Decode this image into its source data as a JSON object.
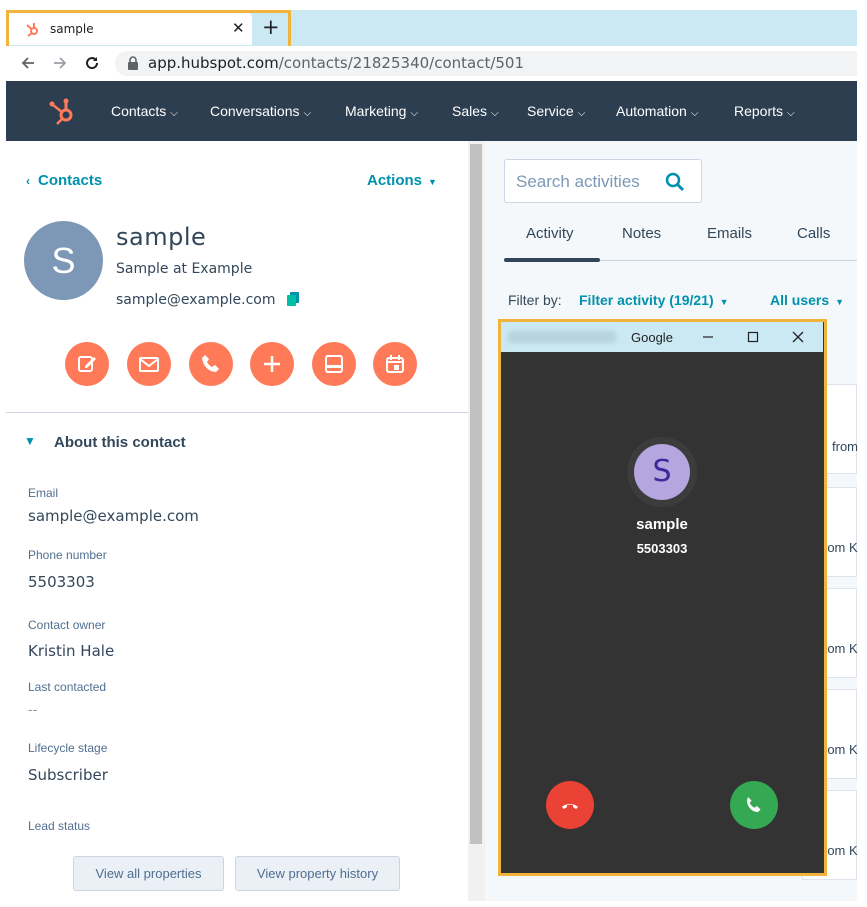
{
  "browser": {
    "tab_title": "sample",
    "tab_close": "✕",
    "new_tab": "+",
    "url_host": "app.hubspot.com",
    "url_path": "/contacts/21825340/contact/501"
  },
  "topnav": {
    "items": [
      "Contacts",
      "Conversations",
      "Marketing",
      "Sales",
      "Service",
      "Automation",
      "Reports"
    ]
  },
  "contact": {
    "back_label": "Contacts",
    "actions_label": "Actions",
    "avatar_letter": "S",
    "name": "sample",
    "company": "Sample at Example",
    "email": "sample@example.com",
    "action_buttons": [
      "note-icon",
      "email-icon",
      "phone-icon",
      "plus-icon",
      "meeting-icon",
      "calendar-icon"
    ]
  },
  "about": {
    "title": "About this contact",
    "properties": [
      {
        "label": "Email",
        "value": "sample@example.com"
      },
      {
        "label": "Phone number",
        "value": "5503303"
      },
      {
        "label": "Contact owner",
        "value": "Kristin Hale"
      },
      {
        "label": "Last contacted",
        "value": "--"
      },
      {
        "label": "Lifecycle stage",
        "value": "Subscriber"
      },
      {
        "label": "Lead status",
        "value": ""
      }
    ],
    "view_all_label": "View all properties",
    "view_history_label": "View property history"
  },
  "activity": {
    "search_placeholder": "Search activities",
    "tabs": [
      "Activity",
      "Notes",
      "Emails",
      "Calls"
    ],
    "active_tab": "Activity",
    "filter_by_label": "Filter by:",
    "filter_activity": "Filter activity (19/21)",
    "all_users": "All users",
    "card_snippets": [
      "from",
      "rom K",
      "rom K",
      "rom K",
      "rom K"
    ]
  },
  "call_window": {
    "title": "Google",
    "caller_initial": "S",
    "caller_name": "sample",
    "caller_number": "5503303"
  },
  "colors": {
    "accent": "#ff7a59",
    "link": "#0091ae",
    "nav_bg": "#2d3e50",
    "decline": "#ea4335",
    "accept": "#34a853",
    "highlight": "#f2b33d"
  }
}
